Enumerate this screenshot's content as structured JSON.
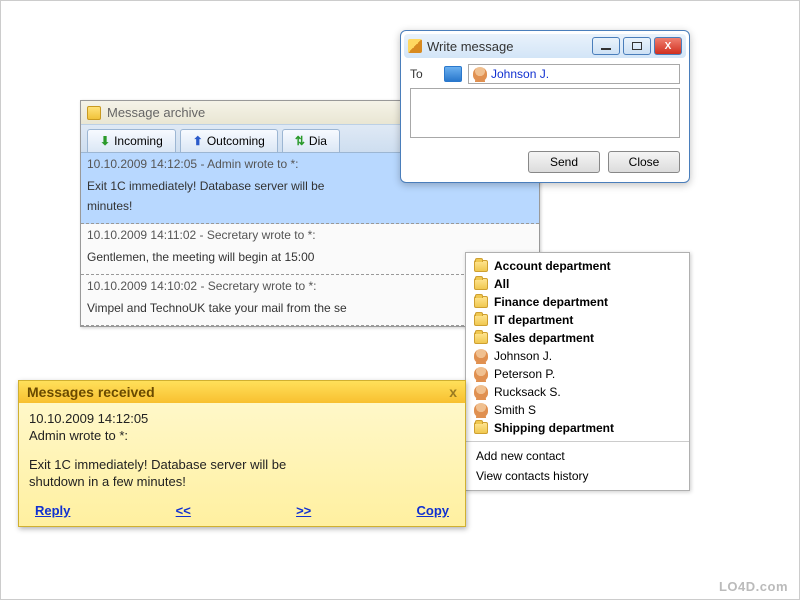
{
  "archive": {
    "title": "Message archive",
    "tabs": {
      "incoming": "Incoming",
      "outcoming": "Outcoming",
      "dialog": "Dia"
    },
    "messages": [
      {
        "header": "10.10.2009 14:12:05 - Admin wrote to *:",
        "body": "Exit 1C immediately! Database server will be",
        "body2": "minutes!"
      },
      {
        "header": "10.10.2009 14:11:02 - Secretary wrote to *:",
        "body": "Gentlemen, the meeting will begin at 15:00"
      },
      {
        "header": "10.10.2009 14:10:02 - Secretary wrote to *:",
        "body": "Vimpel and TechnoUK take your mail from the se"
      }
    ]
  },
  "write": {
    "title": "Write message",
    "to_label": "To",
    "recipient": "Johnson J.",
    "send": "Send",
    "close": "Close"
  },
  "contacts": {
    "items": [
      {
        "type": "dept",
        "label": "Account department"
      },
      {
        "type": "dept",
        "label": "All"
      },
      {
        "type": "dept",
        "label": "Finance department"
      },
      {
        "type": "dept",
        "label": "IT department"
      },
      {
        "type": "dept",
        "label": "Sales department"
      },
      {
        "type": "user",
        "label": "Johnson J."
      },
      {
        "type": "user",
        "label": "Peterson P."
      },
      {
        "type": "user",
        "label": "Rucksack S."
      },
      {
        "type": "user",
        "label": "Smith S"
      },
      {
        "type": "dept",
        "label": "Shipping department"
      }
    ],
    "add": "Add new contact",
    "history": "View contacts history"
  },
  "notif": {
    "title": "Messages received",
    "close": "x",
    "ts": "10.10.2009 14:12:05",
    "from": "Admin wrote to *:",
    "body1": "Exit 1C immediately! Database server will be",
    "body2": "shutdown in a few minutes!",
    "reply": "Reply",
    "prev": "<<",
    "next": ">>",
    "copy": "Copy"
  },
  "watermark": "LO4D.com"
}
